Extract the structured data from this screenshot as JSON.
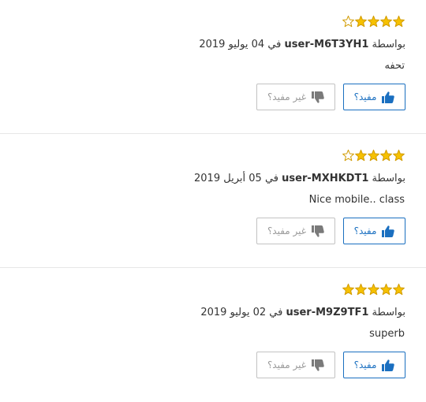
{
  "colors": {
    "star_fill": "#f6c100",
    "star_stroke": "#d19b00",
    "helpful_accent": "#1a6fc0",
    "unhelpful_gray": "#9a9a9a",
    "divider": "#e6e6e6"
  },
  "icons": {
    "star": "star-icon",
    "thumbs_up": "thumbs-up-icon",
    "thumbs_down": "thumbs-down-icon"
  },
  "reviews": [
    {
      "rating": 4,
      "by_prefix": "بواسطة",
      "username": "user-M6T3YH1",
      "in_word": "في",
      "date": "04 يوليو 2019",
      "comment": "تحفه",
      "helpful_label": "مفيد؟",
      "unhelpful_label": "غير مفيد؟"
    },
    {
      "rating": 4,
      "by_prefix": "بواسطة",
      "username": "user-MXHKDT1",
      "in_word": "في",
      "date": "05 أبريل 2019",
      "comment": "Nice mobile.. class",
      "helpful_label": "مفيد؟",
      "unhelpful_label": "غير مفيد؟"
    },
    {
      "rating": 5,
      "by_prefix": "بواسطة",
      "username": "user-M9Z9TF1",
      "in_word": "في",
      "date": "02 يوليو 2019",
      "comment": "superb",
      "helpful_label": "مفيد؟",
      "unhelpful_label": "غير مفيد؟"
    }
  ]
}
